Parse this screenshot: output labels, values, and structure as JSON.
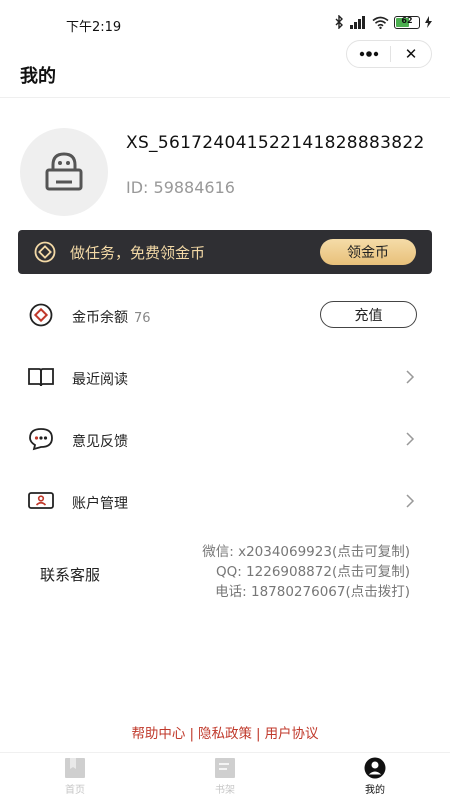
{
  "status_bar": {
    "time": "下午2:19",
    "battery": "62",
    "battery_level": 0.62
  },
  "nav": {
    "title": "我的",
    "more_icon": "more-dots-icon",
    "close_label": "✕"
  },
  "profile": {
    "username": "XS_561724041522141828883822",
    "user_id": "ID: 59884616"
  },
  "task_banner": {
    "text": "做任务，免费领金币",
    "button_label": "领金币"
  },
  "menu": {
    "coins_label": "金币余额",
    "coins_value": "76",
    "recharge_label": "充值",
    "recent_label": "最近阅读",
    "feedback_label": "意见反馈",
    "account_label": "账户管理"
  },
  "service": {
    "title": "联系客服",
    "wechat": "微信: x2034069923(点击可复制)",
    "qq": "QQ: 1226908872(点击可复制)",
    "phone": "电话: 18780276067(点击拨打)"
  },
  "footer": {
    "help": "帮助中心",
    "privacy": "隐私政策",
    "agreement": "用户协议",
    "separator": "|"
  },
  "tabs": [
    {
      "label": "首页",
      "active": false
    },
    {
      "label": "书架",
      "active": false
    },
    {
      "label": "我的",
      "active": true
    }
  ],
  "colors": {
    "banner_bg": "#2f2f33",
    "banner_text": "#f3d9a6",
    "gold_button": "#e8c07a",
    "footer_link": "#c0392b",
    "battery": "#4caf50"
  }
}
